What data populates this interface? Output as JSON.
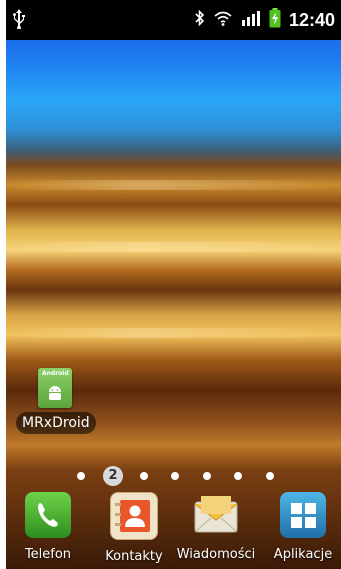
{
  "status_bar": {
    "time": "12:40",
    "icons": [
      "usb-icon",
      "bluetooth-icon",
      "wifi-icon",
      "signal-icon",
      "battery-charging-icon"
    ]
  },
  "home": {
    "shortcut": {
      "label": "MRxDroid",
      "icon_text": "Android",
      "icon": "android-app-icon"
    },
    "pager": {
      "current_page": "2",
      "total_pages": 7
    }
  },
  "dock": {
    "items": [
      {
        "label": "Telefon",
        "icon": "phone-icon",
        "color": "#3dae2b"
      },
      {
        "label": "Kontakty",
        "icon": "contacts-icon",
        "color": "#e8562a"
      },
      {
        "label": "Wiadomości",
        "icon": "messages-icon",
        "color": "#f2c248"
      },
      {
        "label": "Aplikacje",
        "icon": "apps-grid-icon",
        "color": "#2b8fc8"
      }
    ]
  }
}
